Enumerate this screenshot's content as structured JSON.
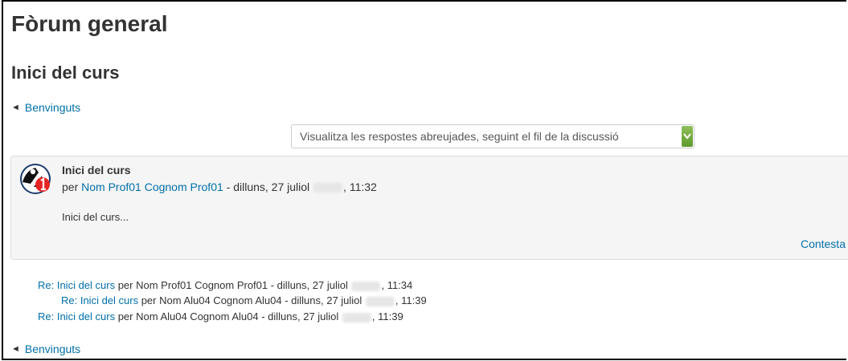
{
  "forum": {
    "title": "Fòrum general"
  },
  "discussion": {
    "title": "Inici del curs"
  },
  "nav": {
    "arrow": "◄",
    "previous_label": "Benvinguts",
    "bottom_label": "Benvinguts"
  },
  "display_mode": {
    "selected": "Visualitza les respostes abreujades, seguint el fil de la discussió"
  },
  "post": {
    "subject": "Inici del curs",
    "by_prefix": "per",
    "author": "Nom Prof01 Cognom Prof01",
    "date_prefix": " - dilluns, 27 juliol ",
    "time_suffix": ", 11:32",
    "content": "Inici del curs...",
    "reply_label": "Contesta"
  },
  "replies": [
    {
      "subject": "Re: Inici del curs",
      "by": " per Nom Prof01 Cognom Prof01 - dilluns, 27 juliol ",
      "time": ", 11:34"
    },
    {
      "subject": "Re: Inici del curs",
      "by": " per Nom Alu04 Cognom Alu04 - dilluns, 27 juliol ",
      "time": ", 11:39"
    },
    {
      "subject": "Re: Inici del curs",
      "by": " per Nom Alu04 Cognom Alu04 - dilluns, 27 juliol ",
      "time": ", 11:39"
    }
  ],
  "colors": {
    "link": "#0070a8",
    "text": "#333333",
    "post_bg": "#f5f5f5",
    "select_button": "#6fa83c"
  }
}
